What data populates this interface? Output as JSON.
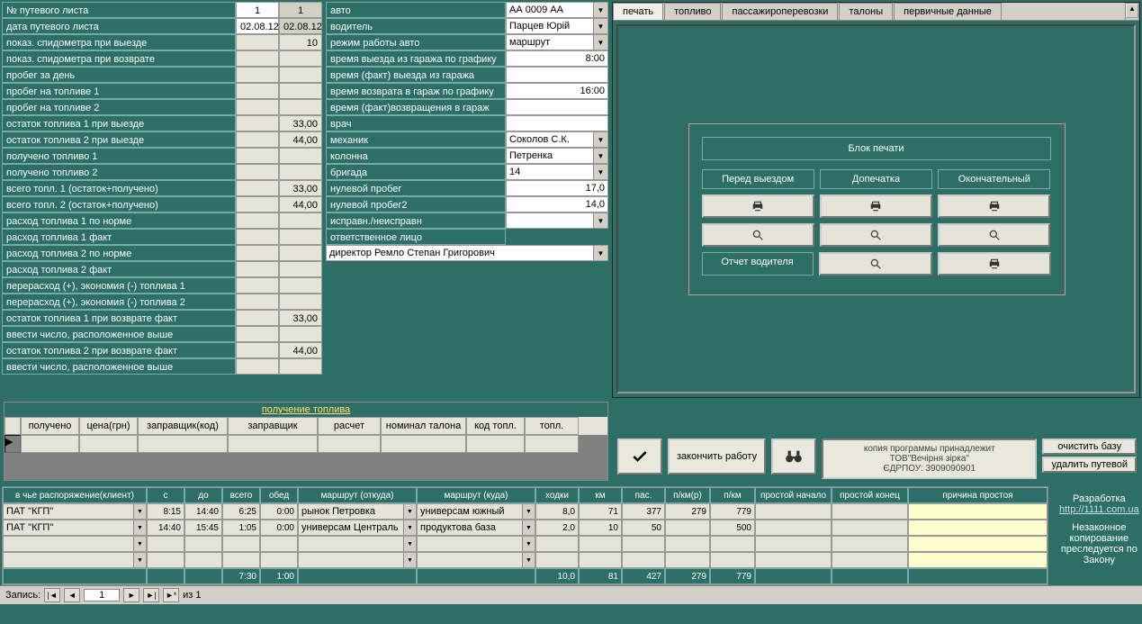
{
  "left": {
    "rows": [
      {
        "label": "№ путевого листа",
        "v1": "1",
        "v2": "1"
      },
      {
        "label": "дата путевого листа",
        "v1": "02.08.12",
        "v2": "02.08.12"
      },
      {
        "label": "показ. спидометра при выезде",
        "v1": "",
        "v2": "10"
      },
      {
        "label": "показ. спидометра при возврате",
        "v1": "",
        "v2": ""
      },
      {
        "label": "пробег за день",
        "v1": "",
        "v2": ""
      },
      {
        "label": "пробег на топливе 1",
        "v1": "",
        "v2": ""
      },
      {
        "label": "пробег на топливе 2",
        "v1": "",
        "v2": ""
      },
      {
        "label": "остаток  топлива 1 при выезде",
        "v1": "",
        "v2": "33,00"
      },
      {
        "label": "остаток топлива 2 при выезде",
        "v1": "",
        "v2": "44,00"
      },
      {
        "label": "получено топливо 1",
        "v1": "",
        "v2": ""
      },
      {
        "label": "получено топливо 2",
        "v1": "",
        "v2": ""
      },
      {
        "label": "всего топл. 1 (остаток+получено)",
        "v1": "",
        "v2": "33,00"
      },
      {
        "label": "всего топл. 2 (остаток+получено)",
        "v1": "",
        "v2": "44,00"
      },
      {
        "label": "расход топлива 1 по норме",
        "v1": "",
        "v2": ""
      },
      {
        "label": "расход топлива 1 факт",
        "v1": "",
        "v2": ""
      },
      {
        "label": "расход топлива 2 по норме",
        "v1": "",
        "v2": ""
      },
      {
        "label": "расход топлива 2 факт",
        "v1": "",
        "v2": ""
      },
      {
        "label": "перерасход (+), экономия (-) топлива 1",
        "v1": "",
        "v2": ""
      },
      {
        "label": "перерасход (+), экономия (-) топлива 2",
        "v1": "",
        "v2": ""
      },
      {
        "label": "остаток топлива 1 при возврате факт",
        "v1": "",
        "v2": "33,00"
      },
      {
        "label": "ввести число, расположенное выше",
        "v1": "",
        "v2": ""
      },
      {
        "label": "остаток топлива 2 при возврате факт",
        "v1": "",
        "v2": "44,00"
      },
      {
        "label": "ввести число, расположенное выше",
        "v1": "",
        "v2": ""
      }
    ]
  },
  "mid": {
    "rows": [
      {
        "label": "авто",
        "type": "drop",
        "val": "АА 0009 АА"
      },
      {
        "label": "водитель",
        "type": "drop",
        "val": "Парцев Юрій Васил"
      },
      {
        "label": "режим работы авто",
        "type": "drop",
        "val": "маршрут"
      },
      {
        "label": "время выезда из гаража по графику",
        "type": "num",
        "val": "8:00"
      },
      {
        "label": "время (факт) выезда из гаража",
        "type": "num",
        "val": ""
      },
      {
        "label": "время возврата в гараж по графику",
        "type": "num",
        "val": "16:00"
      },
      {
        "label": "время (факт)возвращения в гараж",
        "type": "num",
        "val": ""
      },
      {
        "label": "врач",
        "type": "num",
        "val": ""
      },
      {
        "label": "механик",
        "type": "drop",
        "val": "Соколов С.К."
      },
      {
        "label": "колонна",
        "type": "drop",
        "val": "Петренка"
      },
      {
        "label": "бригада",
        "type": "drop",
        "val": "14"
      },
      {
        "label": "нулевой пробег",
        "type": "num",
        "val": "17,0"
      },
      {
        "label": "нулевой пробег2",
        "type": "num",
        "val": "14,0"
      },
      {
        "label": "исправн./неисправн",
        "type": "drop",
        "val": ""
      },
      {
        "label": "ответственное лицо",
        "type": "label",
        "val": ""
      }
    ],
    "responsible": "директор Ремло Степан Григорович"
  },
  "tabs": [
    "печать",
    "топливо",
    "пассажироперевозки",
    "талоны",
    "первичные данные"
  ],
  "print": {
    "title": "Блок печати",
    "cols": [
      "Перед выездом",
      "Допечатка",
      "Окончательный"
    ],
    "driver_report": "Отчет водителя"
  },
  "fuel": {
    "title": "получение топлива",
    "headers": [
      "получено",
      "цена(грн)",
      "заправщик(код)",
      "заправщик",
      "расчет",
      "номинал талона",
      "код топл.",
      "топл."
    ]
  },
  "actions": {
    "finish": "закончить работу",
    "license": "копия программы принадлежит\nТОВ\"Вечірня зірка\"\nЄДРПОУ: 3909090901",
    "clear": "очистить базу",
    "delete": "удалить путевой"
  },
  "route": {
    "headers": [
      "в чье распоряжение(клиент)",
      "с",
      "до",
      "всего",
      "обед",
      "маршрут (откуда)",
      "маршрут (куда)",
      "ходки",
      "км",
      "пас.",
      "п/км(р)",
      "п/км",
      "простой начало",
      "простой конец",
      "причина простоя"
    ],
    "rows": [
      {
        "client": "ПАТ \"КГП\"",
        "from": "8:15",
        "to": "14:40",
        "total": "6:25",
        "lunch": "0:00",
        "r_from": "рынок Петровка",
        "r_to": "универсам южный",
        "trips": "8,0",
        "km": "71",
        "pas": "377",
        "pkmr": "279",
        "pkm": "779",
        "i1": "",
        "i2": "",
        "reason": ""
      },
      {
        "client": "ПАТ \"КГП\"",
        "from": "14:40",
        "to": "15:45",
        "total": "1:05",
        "lunch": "0:00",
        "r_from": "универсам Централь",
        "r_to": "продуктова база",
        "trips": "2,0",
        "km": "10",
        "pas": "50",
        "pkmr": "",
        "pkm": "500",
        "i1": "",
        "i2": "",
        "reason": ""
      }
    ],
    "totals": {
      "total": "7:30",
      "lunch": "1:00",
      "trips": "10,0",
      "km": "81",
      "pas": "427",
      "pkmr": "279",
      "pkm": "779"
    }
  },
  "dev": {
    "line1": "Разработка",
    "link": "http://1111.com.ua",
    "line2": "Незаконное копирование преследуется по Закону"
  },
  "nav": {
    "label": "Запись:",
    "pos": "1",
    "of": "из 1"
  }
}
